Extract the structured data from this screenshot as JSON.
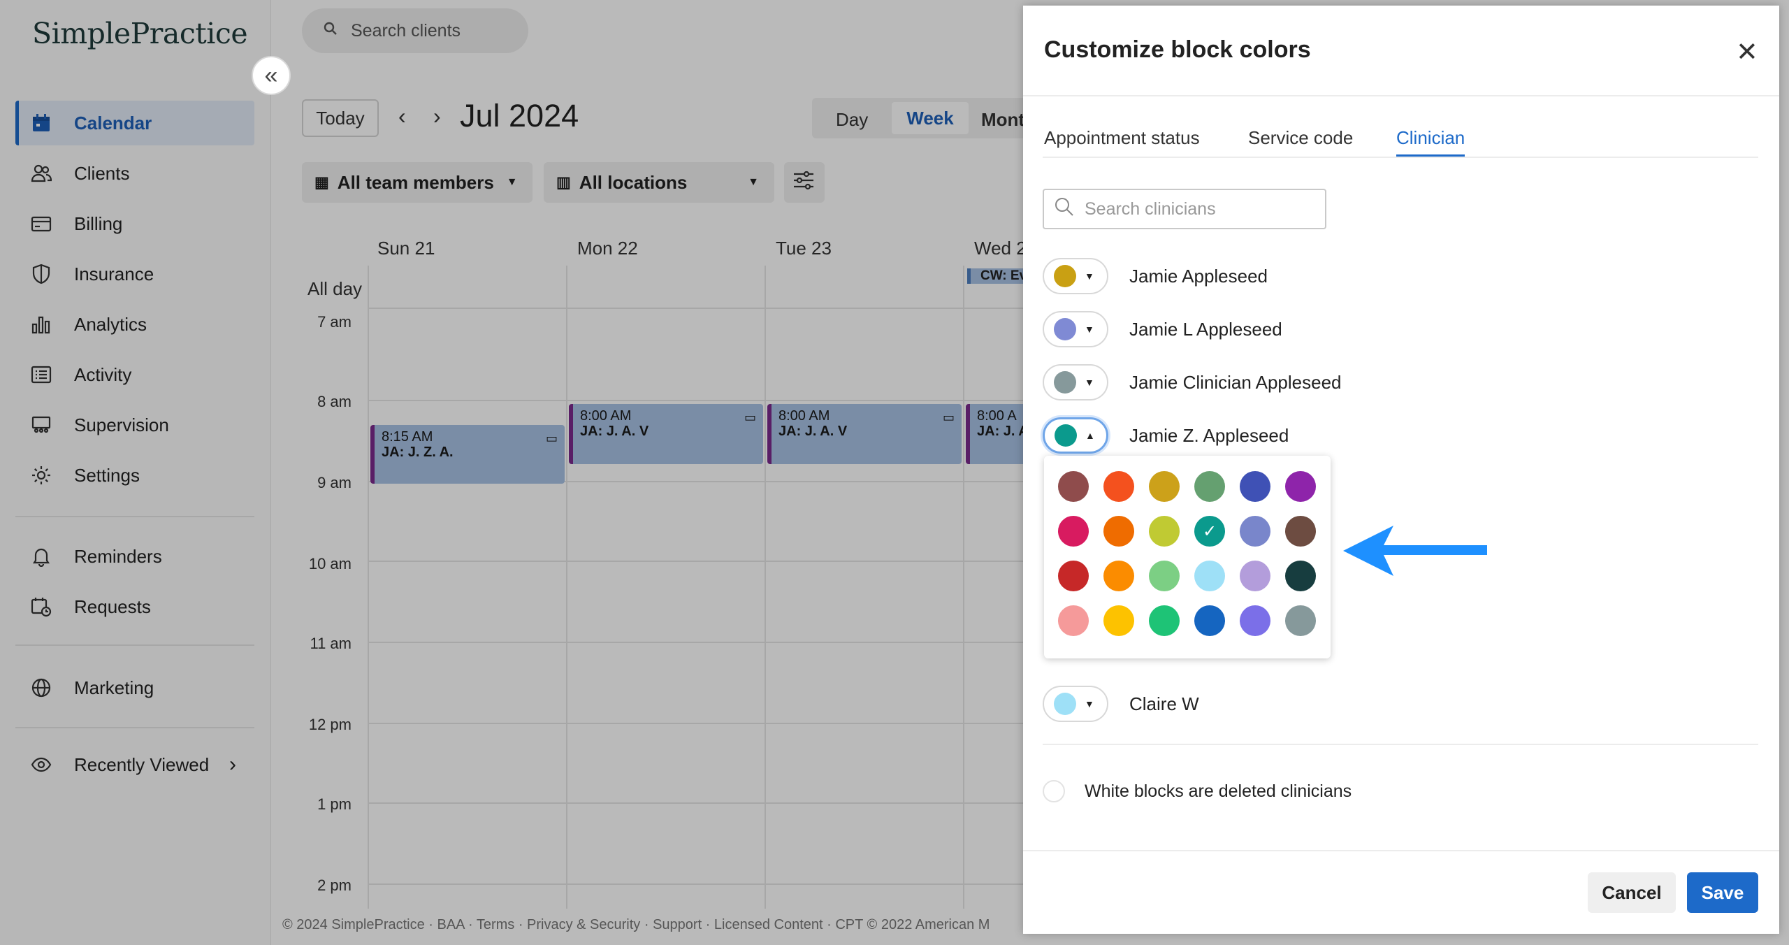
{
  "app": {
    "logo": "SimplePractice",
    "search_placeholder": "Search clients"
  },
  "sidebar": {
    "items": [
      {
        "label": "Calendar",
        "icon": "calendar-icon",
        "active": true
      },
      {
        "label": "Clients",
        "icon": "clients-icon"
      },
      {
        "label": "Billing",
        "icon": "billing-card-icon"
      },
      {
        "label": "Insurance",
        "icon": "shield-icon"
      },
      {
        "label": "Analytics",
        "icon": "bar-chart-icon"
      },
      {
        "label": "Activity",
        "icon": "list-icon"
      },
      {
        "label": "Supervision",
        "icon": "supervision-icon"
      },
      {
        "label": "Settings",
        "icon": "gear-icon"
      },
      {
        "label": "Reminders",
        "icon": "bell-icon"
      },
      {
        "label": "Requests",
        "icon": "calendar-clock-icon"
      },
      {
        "label": "Marketing",
        "icon": "globe-icon"
      },
      {
        "label": "Recently Viewed",
        "icon": "eye-icon"
      }
    ]
  },
  "calendar": {
    "today_label": "Today",
    "month": "Jul 2024",
    "views": [
      "Day",
      "Week",
      "Mont"
    ],
    "active_view": "Week",
    "filter_team": "All team members",
    "filter_locations": "All locations",
    "days": [
      "Sun 21",
      "Mon 22",
      "Tue 23",
      "Wed 2"
    ],
    "all_day_label": "All day",
    "all_day_event": "CW: Ev",
    "times": [
      "7 am",
      "8 am",
      "9 am",
      "10 am",
      "11 am",
      "12 pm",
      "1 pm",
      "2 pm"
    ],
    "appointments": [
      {
        "time": "8:15 AM",
        "title": "JA: J. Z. A."
      },
      {
        "time": "8:00 AM",
        "title": "JA: J. A. V"
      },
      {
        "time": "8:00 AM",
        "title": "JA: J. A. V"
      },
      {
        "time": "8:00 A",
        "title": "JA: J. A"
      }
    ]
  },
  "footer": "© 2024 SimplePractice · BAA · Terms · Privacy & Security · Support · Licensed Content · CPT © 2022 American M",
  "modal": {
    "title": "Customize block colors",
    "tabs": [
      "Appointment status",
      "Service code",
      "Clinician"
    ],
    "active_tab": "Clinician",
    "search_placeholder": "Search clinicians",
    "clinicians": [
      {
        "name": "Jamie Appleseed",
        "color": "#c9a013"
      },
      {
        "name": "Jamie L Appleseed",
        "color": "#7f8ad4"
      },
      {
        "name": "Jamie Clinician Appleseed",
        "color": "#86999b"
      },
      {
        "name": "Jamie Z. Appleseed",
        "color": "#0b9a8d"
      },
      {
        "name": "Claire W",
        "color": "#9ee0f7"
      }
    ],
    "palette": [
      [
        "#8f4c4c",
        "#f4511e",
        "#cca11a",
        "#65a070",
        "#3f51b5",
        "#8e24aa"
      ],
      [
        "#d81b60",
        "#ef6c00",
        "#c0ca33",
        "#0b9a8d",
        "#7986cb",
        "#6d4c41"
      ],
      [
        "#c62828",
        "#fb8c00",
        "#7ccf84",
        "#9ee0f7",
        "#b39ddb",
        "#173d3f"
      ],
      [
        "#f59a9a",
        "#fdc200",
        "#1ec376",
        "#1565c0",
        "#7b6fe8",
        "#86999b"
      ]
    ],
    "selected_color": "#0b9a8d",
    "note": "White blocks are deleted clinicians",
    "cancel": "Cancel",
    "save": "Save"
  }
}
